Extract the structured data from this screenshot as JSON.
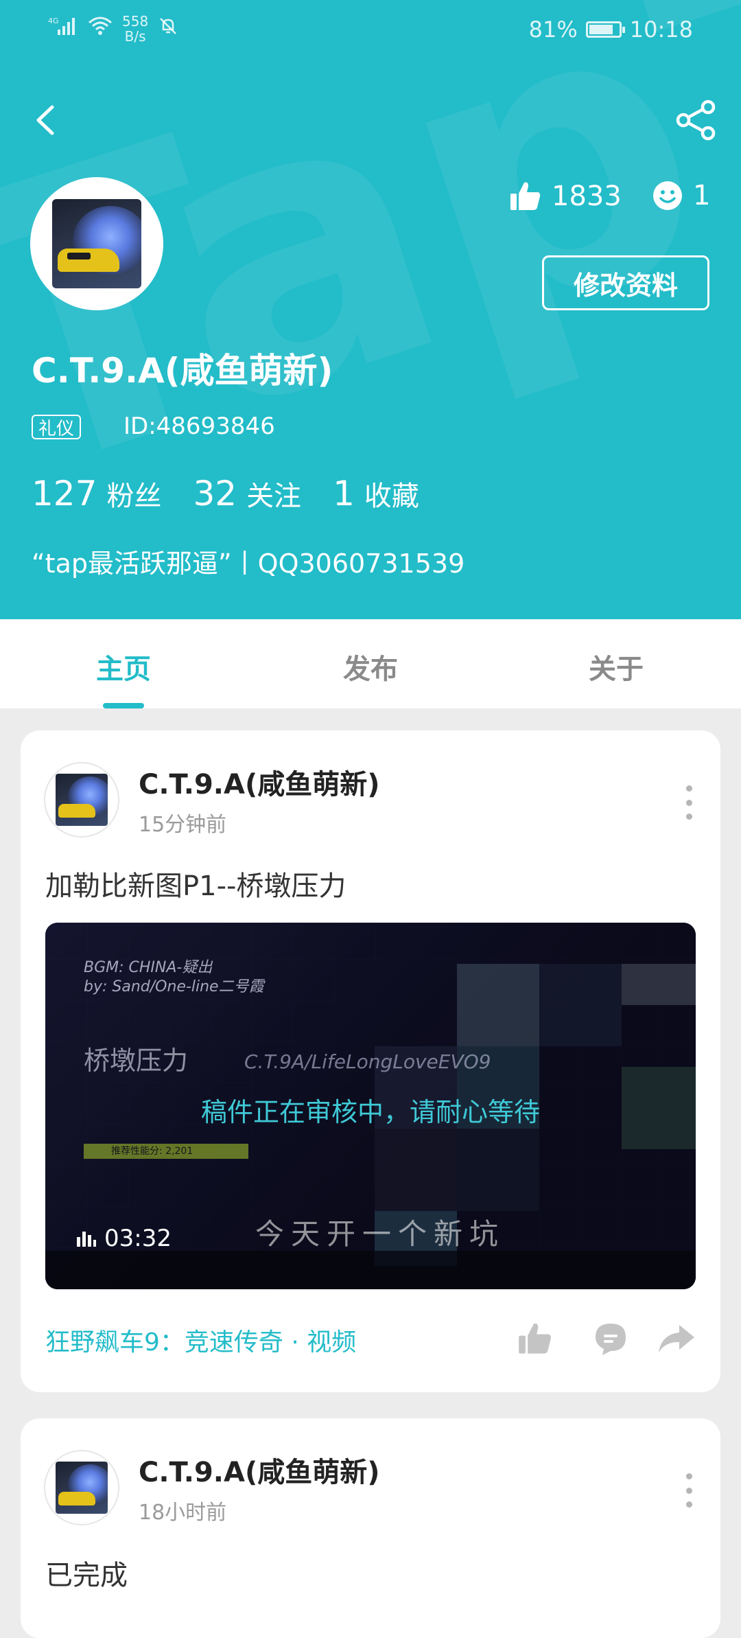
{
  "status_bar": {
    "network": "4G",
    "speed_value": "558",
    "speed_unit": "B/s",
    "battery": "81%",
    "battery_level": 0.81,
    "time": "10:18"
  },
  "header": {
    "watermark": "TapTap",
    "likes_count": "1833",
    "mood_count": "1",
    "edit_label": "修改资料",
    "username": "C.T.9.A(咸鱼萌新)",
    "badge": "礼仪",
    "user_id": "ID:48693846",
    "fans_count": "127",
    "fans_label": "粉丝",
    "following_count": "32",
    "following_label": "关注",
    "favorites_count": "1",
    "favorites_label": "收藏",
    "signature": "“tap最活跃那逼”丨QQ3060731539",
    "accent_color": "#23bcc9"
  },
  "tabs": [
    {
      "label": "主页",
      "active": true
    },
    {
      "label": "发布",
      "active": false
    },
    {
      "label": "关于",
      "active": false
    }
  ],
  "posts": [
    {
      "author": "C.T.9.A(咸鱼萌新)",
      "time": "15分钟前",
      "text": "加勒比新图P1--桥墩压力",
      "video": {
        "bgm_line1": "BGM: CHINA-疑出",
        "bgm_line2": "by: Sand/One-line二号霞",
        "title_overlay": "桥墩压力",
        "signature_overlay": "C.T.9A/LifeLongLoveEVO9",
        "rating_bar": "推荐性能分: 2,201",
        "caption_overlay": "今天开一个新坑",
        "review_notice": "稿件正在审核中，请耐心等待",
        "duration": "03:32"
      },
      "tag": "狂野飙车9：竞速传奇 · 视频"
    },
    {
      "author": "C.T.9.A(咸鱼萌新)",
      "time": "18小时前",
      "text": "已完成"
    }
  ]
}
